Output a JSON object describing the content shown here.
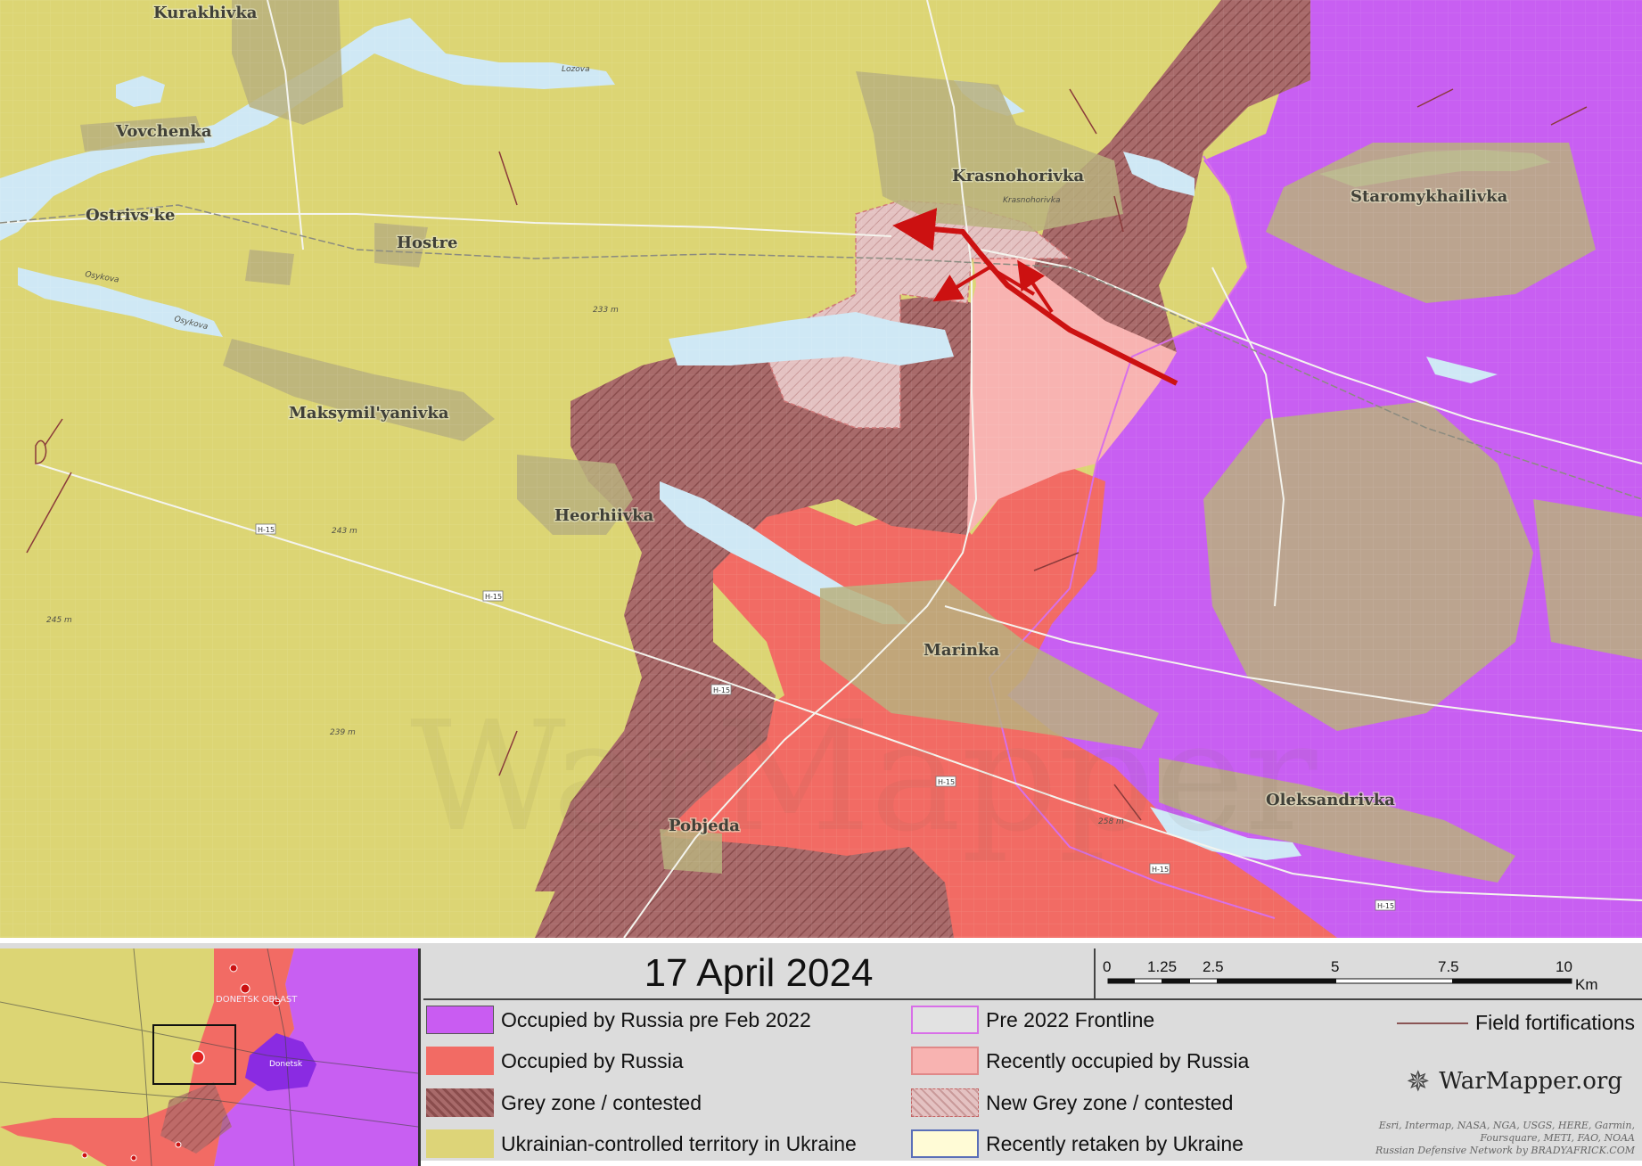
{
  "map": {
    "places": [
      {
        "name": "Kurakhivka"
      },
      {
        "name": "Vovchenka"
      },
      {
        "name": "Ostrivs'ke"
      },
      {
        "name": "Hostre"
      },
      {
        "name": "Krasnohorivka"
      },
      {
        "name": "Staromykhailivka"
      },
      {
        "name": "Maksymil'yanivka"
      },
      {
        "name": "Heorhiivka"
      },
      {
        "name": "Marinka"
      },
      {
        "name": "Pobjeda"
      },
      {
        "name": "Oleksandrivka"
      }
    ],
    "small_labels": {
      "krasnohorivka_station": "Krasnohorivka",
      "lozova": "Lozova",
      "osykova1": "Osykova",
      "osykova2": "Osykova",
      "elev_233": "233 m",
      "elev_243": "243 m",
      "elev_245": "245 m",
      "elev_239": "239 m",
      "elev_258": "258 m"
    },
    "roads": {
      "h15_1": "H-15",
      "h15_2": "H-15",
      "h15_3": "H-15",
      "h15_4": "H-15",
      "h15_5": "H-15",
      "h15_6": "H-15"
    },
    "watermark": "WarMapper"
  },
  "inset": {
    "label_oblast": "DONETSK OBLAST",
    "label_city": "Donetsk"
  },
  "header": {
    "date": "17 April 2024"
  },
  "scale": {
    "ticks": [
      "0",
      "1.25",
      "2.5",
      "5",
      "7.5",
      "10"
    ],
    "unit": "Km"
  },
  "legend": {
    "items": [
      {
        "label": "Occupied by Russia pre Feb 2022",
        "color": "#c95cf2"
      },
      {
        "label": "Occupied by Russia",
        "color": "#f26b64"
      },
      {
        "label": "Grey zone / contested",
        "color": "#a45f5f"
      },
      {
        "label": "Ukrainian-controlled territory in Ukraine",
        "color": "#ddd478"
      },
      {
        "label": "Pre 2022 Frontline",
        "color": "#d86fe8"
      },
      {
        "label": "Recently occupied by Russia",
        "color": "#f8b3b1"
      },
      {
        "label": "New Grey zone / contested",
        "color": "#e6c0c0"
      },
      {
        "label": "Recently retaken by Ukraine",
        "color": "#fffbd6"
      }
    ],
    "fortifications": "Field fortifications"
  },
  "brand": {
    "name": "WarMapper.org",
    "credits": [
      "Esri, Intermap, NASA, NGA, USGS, HERE, Garmin,",
      "Foursquare, METI, FAO, NOAA",
      "Russian Defensive Network by BRADYAFRICK.COM"
    ]
  }
}
